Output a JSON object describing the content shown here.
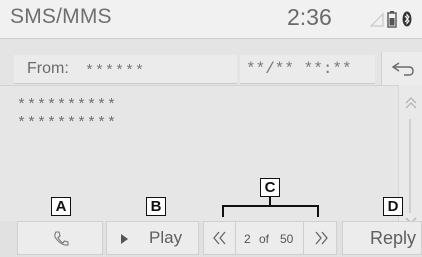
{
  "title_bar": {
    "app_title": "SMS/MMS",
    "clock": "2:36",
    "status_icons": [
      "signal-icon",
      "battery-icon",
      "bluetooth-icon"
    ]
  },
  "message_header": {
    "from_label": "From:",
    "from_value": "******",
    "date_time": "**/** **:**",
    "back_icon": "return-arrow-icon"
  },
  "message_body": {
    "lines": [
      "**********",
      "**********"
    ]
  },
  "scroll": {
    "up_icon": "double-chevron-up-icon",
    "down_icon": "double-chevron-down-icon"
  },
  "bottom_bar": {
    "call_icon": "phone-icon",
    "play_icon": "play-triangle-icon",
    "play_label": "Play",
    "prev_icon": "double-chevron-left-icon",
    "next_icon": "double-chevron-right-icon",
    "page_current": "2",
    "page_of": "of",
    "page_total": "50",
    "reply_label": "Reply"
  },
  "callouts": {
    "a": "A",
    "b": "B",
    "c": "C",
    "d": "D"
  },
  "colors": {
    "screen_bg": "#e4e4e4",
    "button_bg": "#ececec",
    "text": "#5f5f5f",
    "callout_border": "#111111"
  }
}
